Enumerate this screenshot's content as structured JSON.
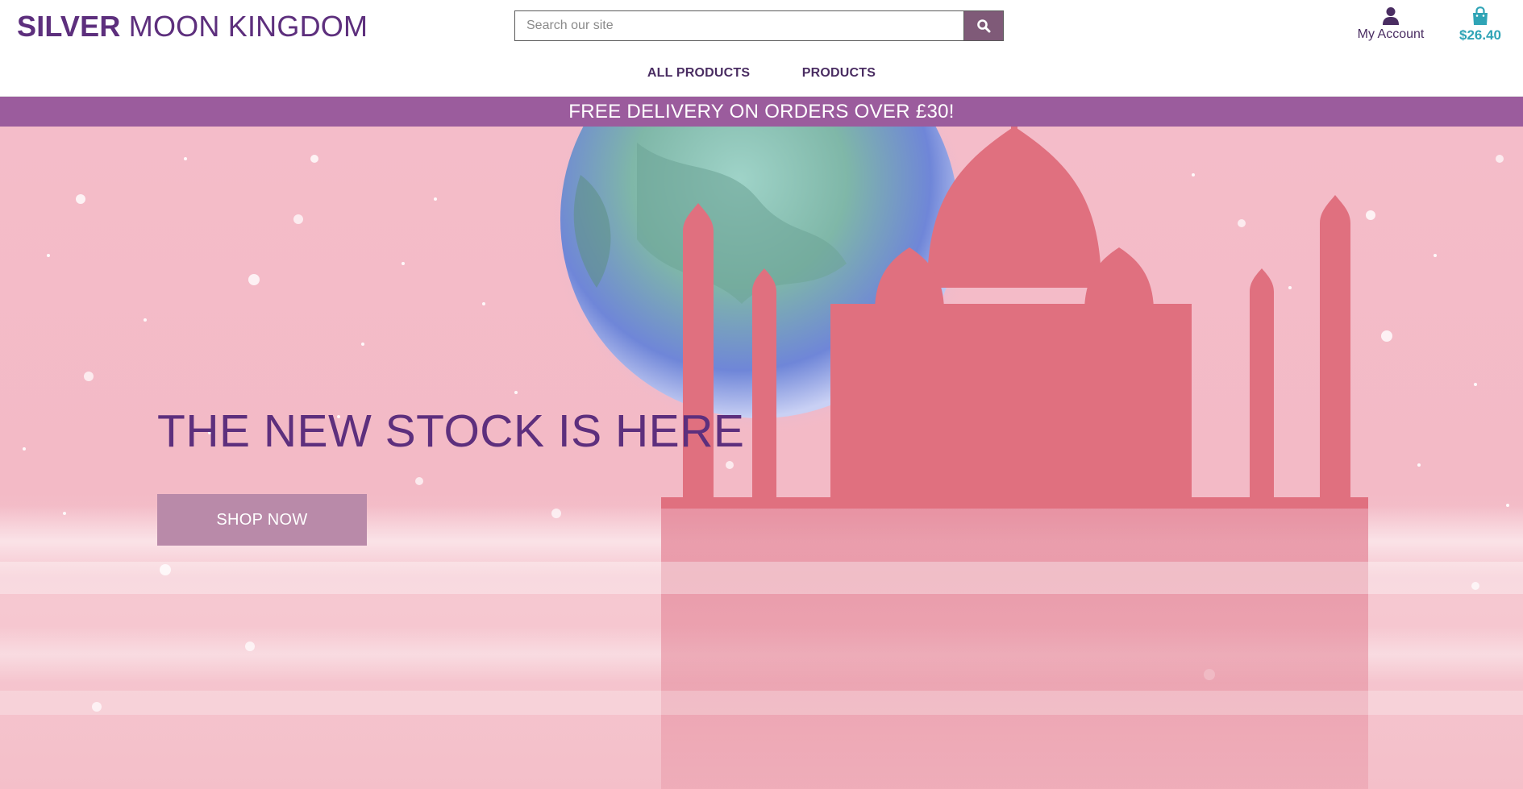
{
  "brand": {
    "name_strong": "SILVER",
    "name_light": "MOON KINGDOM",
    "primary_color": "#5d2f7d"
  },
  "search": {
    "placeholder": "Search our site",
    "value": "",
    "icon": "search-icon"
  },
  "account": {
    "label": "My Account",
    "icon": "user-icon"
  },
  "cart": {
    "total": "$26.40",
    "icon": "shopping-bag-icon",
    "color": "#2fa4b6"
  },
  "nav": {
    "items": [
      {
        "label": "ALL PRODUCTS"
      },
      {
        "label": "PRODUCTS"
      }
    ]
  },
  "banner": {
    "text": "FREE DELIVERY ON ORDERS OVER £30!",
    "background": "#9b5c9d"
  },
  "hero": {
    "title": "THE NEW STOCK IS HERE",
    "cta_label": "SHOP NOW",
    "cta_color": "#b98aa9"
  }
}
